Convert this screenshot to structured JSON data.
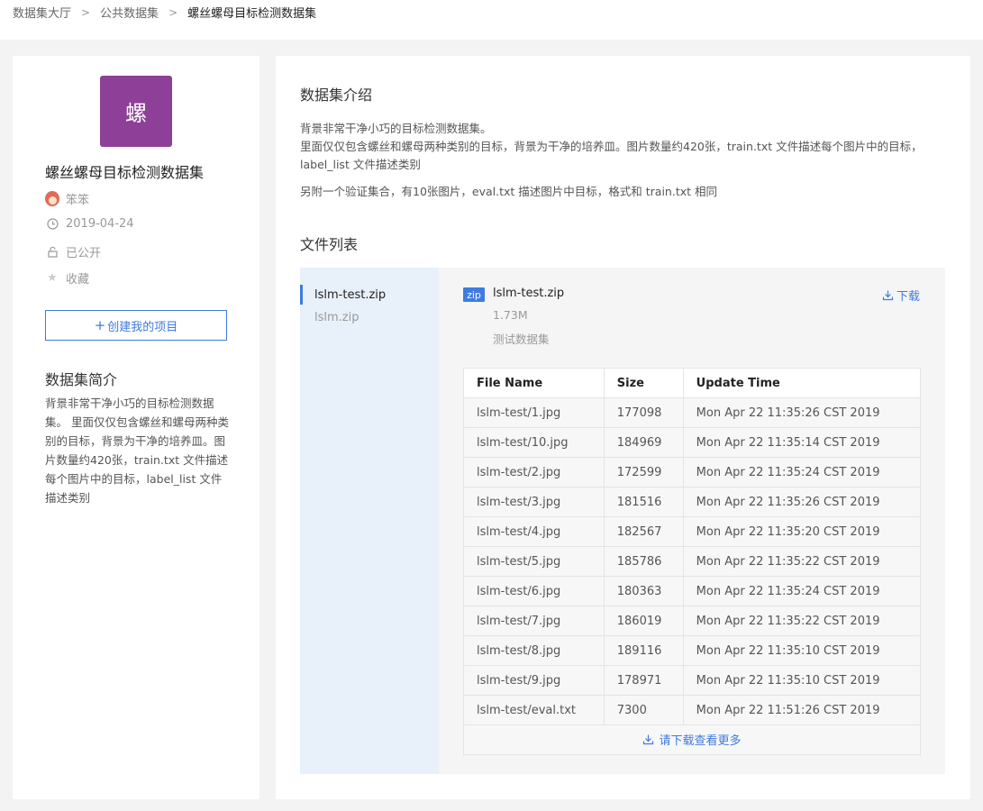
{
  "breadcrumb": [
    "数据集大厅",
    "公共数据集",
    "螺丝螺母目标检测数据集"
  ],
  "sidebar": {
    "logo_text": "螺",
    "logo_color": "#8e3f97",
    "title": "螺丝螺母目标检测数据集",
    "author": "笨笨",
    "date": "2019-04-24",
    "visibility": "已公开",
    "favorite": "收藏",
    "create_button": "创建我的项目",
    "intro_heading": "数据集简介",
    "intro_text": "背景非常干净小巧的目标检测数据集。 里面仅仅包含螺丝和螺母两种类别的目标，背景为干净的培养皿。图片数量约420张，train.txt 文件描述每个图片中的目标，label_list 文件描述类别"
  },
  "main": {
    "intro_title": "数据集介绍",
    "desc_line1": "背景非常干净小巧的目标检测数据集。",
    "desc_line2": "里面仅仅包含螺丝和螺母两种类别的目标，背景为干净的培养皿。图片数量约420张，train.txt 文件描述每个图片中的目标，label_list 文件描述类别",
    "desc_line3": "另附一个验证集合，有10张图片，eval.txt 描述图片中目标，格式和 train.txt 相同",
    "files_title": "文件列表",
    "files": [
      "lslm-test.zip",
      "lslm.zip"
    ],
    "selected": {
      "tag": "zip",
      "name": "lslm-test.zip",
      "size": "1.73M",
      "description": "测试数据集",
      "download": "下载"
    },
    "table": {
      "headers": [
        "File Name",
        "Size",
        "Update Time"
      ],
      "rows": [
        [
          "lslm-test/1.jpg",
          "177098",
          "Mon Apr 22 11:35:26 CST 2019"
        ],
        [
          "lslm-test/10.jpg",
          "184969",
          "Mon Apr 22 11:35:14 CST 2019"
        ],
        [
          "lslm-test/2.jpg",
          "172599",
          "Mon Apr 22 11:35:24 CST 2019"
        ],
        [
          "lslm-test/3.jpg",
          "181516",
          "Mon Apr 22 11:35:26 CST 2019"
        ],
        [
          "lslm-test/4.jpg",
          "182567",
          "Mon Apr 22 11:35:20 CST 2019"
        ],
        [
          "lslm-test/5.jpg",
          "185786",
          "Mon Apr 22 11:35:22 CST 2019"
        ],
        [
          "lslm-test/6.jpg",
          "180363",
          "Mon Apr 22 11:35:24 CST 2019"
        ],
        [
          "lslm-test/7.jpg",
          "186019",
          "Mon Apr 22 11:35:22 CST 2019"
        ],
        [
          "lslm-test/8.jpg",
          "189116",
          "Mon Apr 22 11:35:10 CST 2019"
        ],
        [
          "lslm-test/9.jpg",
          "178971",
          "Mon Apr 22 11:35:10 CST 2019"
        ],
        [
          "lslm-test/eval.txt",
          "7300",
          "Mon Apr 22 11:51:26 CST 2019"
        ]
      ],
      "more": "请下载查看更多"
    }
  }
}
